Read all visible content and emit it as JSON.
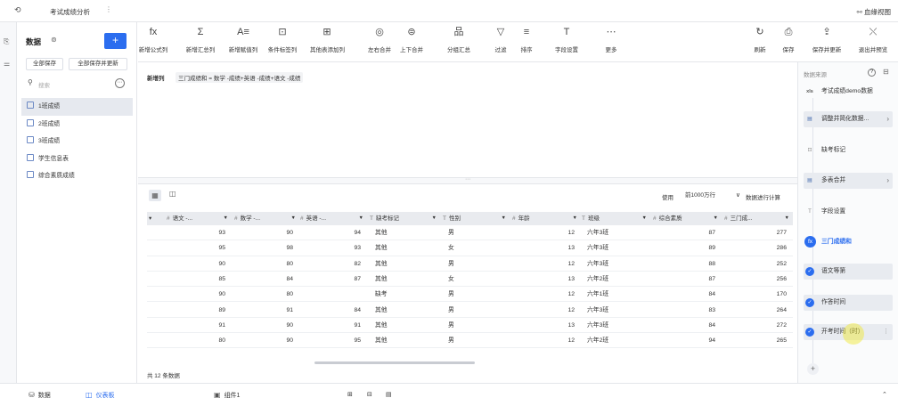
{
  "topbar": {
    "title": "考试成绩分析",
    "more": "⋮",
    "right_view": "血缘视图"
  },
  "left": {
    "title": "数据",
    "add": "+",
    "save_all": "全部保存",
    "save_all_update": "全部保存并更新",
    "search_placeholder": "搜索",
    "tree": [
      "1班成绩",
      "2班成绩",
      "3班成绩",
      "学生信息表",
      "综合素质成绩"
    ]
  },
  "toolbar": {
    "items": [
      {
        "icon": "fx",
        "label": "新增公式列"
      },
      {
        "icon": "Σ",
        "label": "新增汇总列"
      },
      {
        "icon": "A≡",
        "label": "新增赋值列"
      },
      {
        "icon": "⊡",
        "label": "条件标签列"
      },
      {
        "icon": "⊞",
        "label": "其他表添加列"
      },
      {
        "icon": "◎",
        "label": "左右合并"
      },
      {
        "icon": "⊜",
        "label": "上下合并"
      },
      {
        "icon": "品",
        "label": "分组汇总"
      },
      {
        "icon": "▽",
        "label": "过滤"
      },
      {
        "icon": "≡",
        "label": "排序"
      },
      {
        "icon": "T",
        "label": "字段设置"
      },
      {
        "icon": "⋯",
        "label": "更多"
      }
    ],
    "right": [
      {
        "icon": "↻",
        "label": "刷新"
      },
      {
        "icon": "⎙",
        "label": "保存"
      },
      {
        "icon": "⇪",
        "label": "保存并更新"
      },
      {
        "icon": "⤬",
        "label": "退出并预览"
      }
    ]
  },
  "formula": {
    "tag": "新增列",
    "expr": "三门成绩和 = 数学 -成绩+英语 -成绩+语文 -成绩"
  },
  "grid": {
    "use_label": "使用",
    "rows_option": "前1000万行",
    "calc_label": "数据进行计算",
    "columns": [
      {
        "sym": "#",
        "label": "语文 -..."
      },
      {
        "sym": "#",
        "label": "数学 -..."
      },
      {
        "sym": "#",
        "label": "英语 -..."
      },
      {
        "sym": "T",
        "label": "缺考标记"
      },
      {
        "sym": "T",
        "label": "性别"
      },
      {
        "sym": "#",
        "label": "年龄"
      },
      {
        "sym": "T",
        "label": "班级"
      },
      {
        "sym": "#",
        "label": "综合素质"
      },
      {
        "sym": "#",
        "label": "三门成..."
      }
    ],
    "rows": [
      [
        "93",
        "90",
        "94",
        "其他",
        "男",
        "12",
        "六年3班",
        "87",
        "277"
      ],
      [
        "95",
        "98",
        "93",
        "其他",
        "女",
        "13",
        "六年3班",
        "89",
        "286"
      ],
      [
        "90",
        "80",
        "82",
        "其他",
        "男",
        "12",
        "六年3班",
        "88",
        "252"
      ],
      [
        "85",
        "84",
        "87",
        "其他",
        "女",
        "13",
        "六年2班",
        "87",
        "256"
      ],
      [
        "90",
        "80",
        "",
        "缺考",
        "男",
        "12",
        "六年1班",
        "84",
        "170"
      ],
      [
        "89",
        "91",
        "84",
        "其他",
        "男",
        "12",
        "六年3班",
        "83",
        "264"
      ],
      [
        "91",
        "90",
        "91",
        "其他",
        "男",
        "13",
        "六年3班",
        "84",
        "272"
      ],
      [
        "80",
        "90",
        "95",
        "其他",
        "男",
        "12",
        "六年2班",
        "94",
        "265"
      ]
    ],
    "count": "共 12 条数据"
  },
  "right_panel": {
    "title": "数据来源",
    "steps": [
      {
        "icon": "xls",
        "label": "考试成绩demo数据"
      },
      {
        "icon": "▤",
        "label": "调整并简化数据..."
      },
      {
        "icon": "⊡",
        "label": "缺考标记"
      },
      {
        "icon": "▤",
        "label": "多表合并"
      },
      {
        "icon": "T",
        "label": "字段设置"
      },
      {
        "icon": "fx",
        "label": "三门成绩和"
      },
      {
        "icon": "✓",
        "label": "语文等第"
      },
      {
        "icon": "✓",
        "label": "作答时间"
      },
      {
        "icon": "✓",
        "label": "开考时间（时）"
      }
    ],
    "add": "+"
  },
  "bottom": {
    "data_tab": "数据",
    "dashboard_tab": "仪表板",
    "component": "组件1"
  }
}
